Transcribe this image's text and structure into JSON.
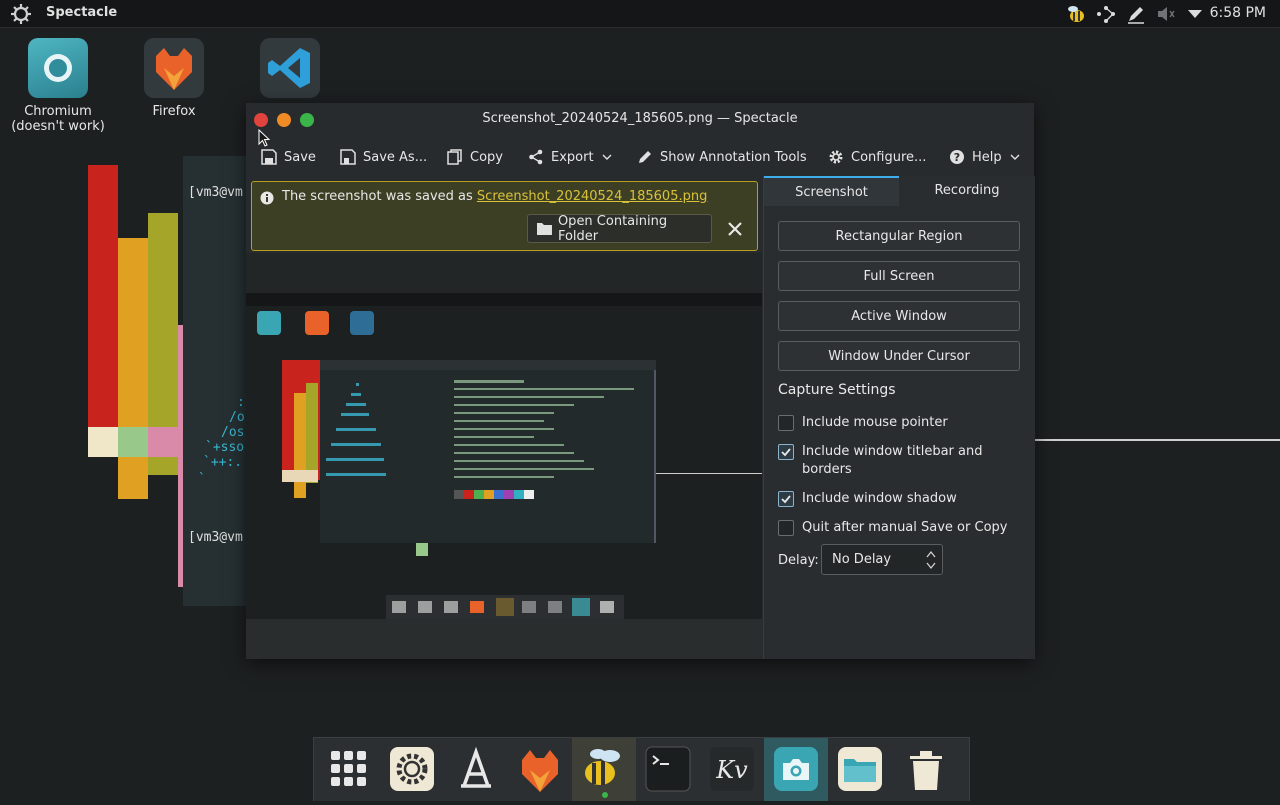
{
  "panel": {
    "active_app": "Spectacle",
    "clock": "6:58 PM"
  },
  "desktop": {
    "icons": [
      {
        "label": "Chromium\n(doesn't work)",
        "label_line1": "Chromium",
        "label_line2": "(doesn't work)"
      },
      {
        "label": "Firefox"
      },
      {
        "label": ""
      }
    ],
    "terminal_prompt_1": "[vm3@vm",
    "terminal_prompt_2": "[vm3@vm",
    "ascii_lines": [
      ":",
      "/o",
      "/os",
      "`+sso",
      "`++:.",
      "`"
    ]
  },
  "window": {
    "title": "Screenshot_20240524_185605.png — Spectacle",
    "toolbar": {
      "save": "Save",
      "save_as": "Save As...",
      "copy": "Copy",
      "export": "Export",
      "annotate": "Show Annotation Tools",
      "configure": "Configure...",
      "help": "Help"
    },
    "banner": {
      "text": "The screenshot was saved as ",
      "link": "Screenshot_20240524_185605.png",
      "open_folder": "Open Containing Folder"
    },
    "tabs": {
      "screenshot": "Screenshot",
      "recording": "Recording"
    },
    "modes": [
      "Rectangular Region",
      "Full Screen",
      "Active Window",
      "Window Under Cursor"
    ],
    "capture_settings": {
      "heading": "Capture Settings",
      "options": [
        {
          "label": "Include mouse pointer",
          "checked": false
        },
        {
          "label": "Include window titlebar and borders",
          "checked": true
        },
        {
          "label": "Include window shadow",
          "checked": true
        },
        {
          "label": "Quit after manual Save or Copy",
          "checked": false
        }
      ],
      "delay_label": "Delay:",
      "delay_value": "No Delay"
    }
  },
  "dock": {
    "items": [
      "app-launcher",
      "settings",
      "app-store",
      "firefox",
      "bee",
      "terminal",
      "kv",
      "spectacle",
      "files",
      "trash"
    ]
  },
  "colors": {
    "accent": "#3daee9",
    "banner_border": "#b5a020",
    "close": "#e0443e",
    "min": "#f08a24",
    "max": "#3bb54a"
  }
}
